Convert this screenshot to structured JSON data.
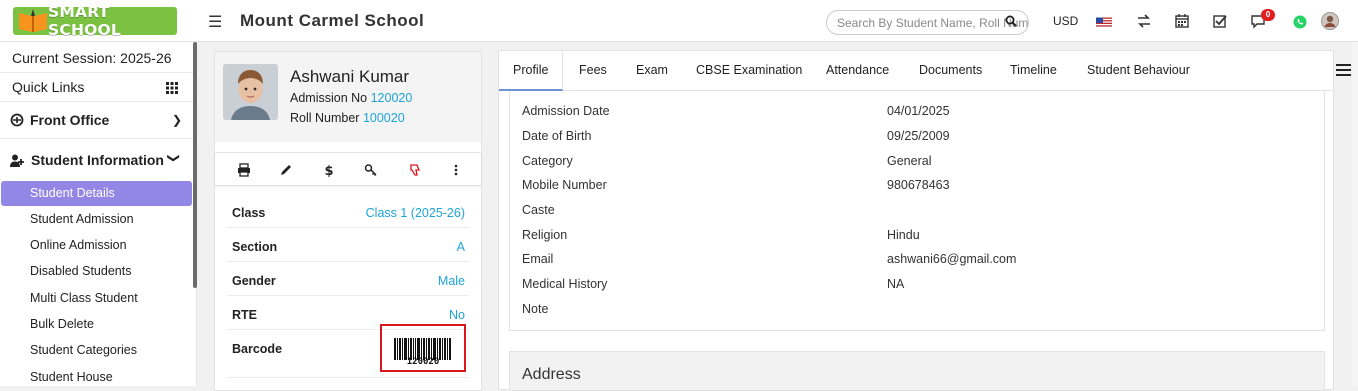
{
  "header": {
    "brand": "SMART SCHOOL",
    "school_name": "Mount Carmel School",
    "search_placeholder": "Search By Student Name, Roll Number, Enroll Number, National Id, Local Id Etc.",
    "currency": "USD",
    "notification_count": "0",
    "icons": [
      "menu-icon",
      "search-icon",
      "us-flag-icon",
      "swap-icon",
      "calendar-icon",
      "checkbox-icon",
      "chat-icon",
      "whatsapp-icon",
      "user-avatar"
    ]
  },
  "sidebar": {
    "session": "Current Session: 2025-26",
    "quick_links": "Quick Links",
    "front_office": "Front Office",
    "student_information": "Student Information",
    "items": [
      {
        "label": "Student Details",
        "active": true
      },
      {
        "label": "Student Admission"
      },
      {
        "label": "Online Admission"
      },
      {
        "label": "Disabled Students"
      },
      {
        "label": "Multi Class Student"
      },
      {
        "label": "Bulk Delete"
      },
      {
        "label": "Student Categories"
      },
      {
        "label": "Student House"
      }
    ]
  },
  "profile": {
    "name": "Ashwani Kumar",
    "admission_label": "Admission No",
    "admission_no": "120020",
    "roll_label": "Roll Number",
    "roll_no": "100020",
    "fields": [
      {
        "key": "Class",
        "value": "Class 1 (2025-26)"
      },
      {
        "key": "Section",
        "value": "A"
      },
      {
        "key": "Gender",
        "value": "Male"
      },
      {
        "key": "RTE",
        "value": "No"
      },
      {
        "key": "Barcode",
        "value": ""
      }
    ],
    "barcode_text": "120020"
  },
  "tabs": [
    "Profile",
    "Fees",
    "Exam",
    "CBSE Examination",
    "Attendance",
    "Documents",
    "Timeline",
    "Student Behaviour"
  ],
  "details": [
    {
      "label": "Admission Date",
      "value": "04/01/2025"
    },
    {
      "label": "Date of Birth",
      "value": "09/25/2009"
    },
    {
      "label": "Category",
      "value": "General"
    },
    {
      "label": "Mobile Number",
      "value": "980678463"
    },
    {
      "label": "Caste",
      "value": ""
    },
    {
      "label": "Religion",
      "value": "Hindu"
    },
    {
      "label": "Email",
      "value": "ashwani66@gmail.com"
    },
    {
      "label": "Medical History",
      "value": "NA"
    },
    {
      "label": "Note",
      "value": ""
    }
  ],
  "address_title": "Address",
  "colors": {
    "brand_green": "#7cc242",
    "accent_purple": "#9387e6",
    "link_blue": "#1ea4d9",
    "alert_red": "#d9161b"
  }
}
